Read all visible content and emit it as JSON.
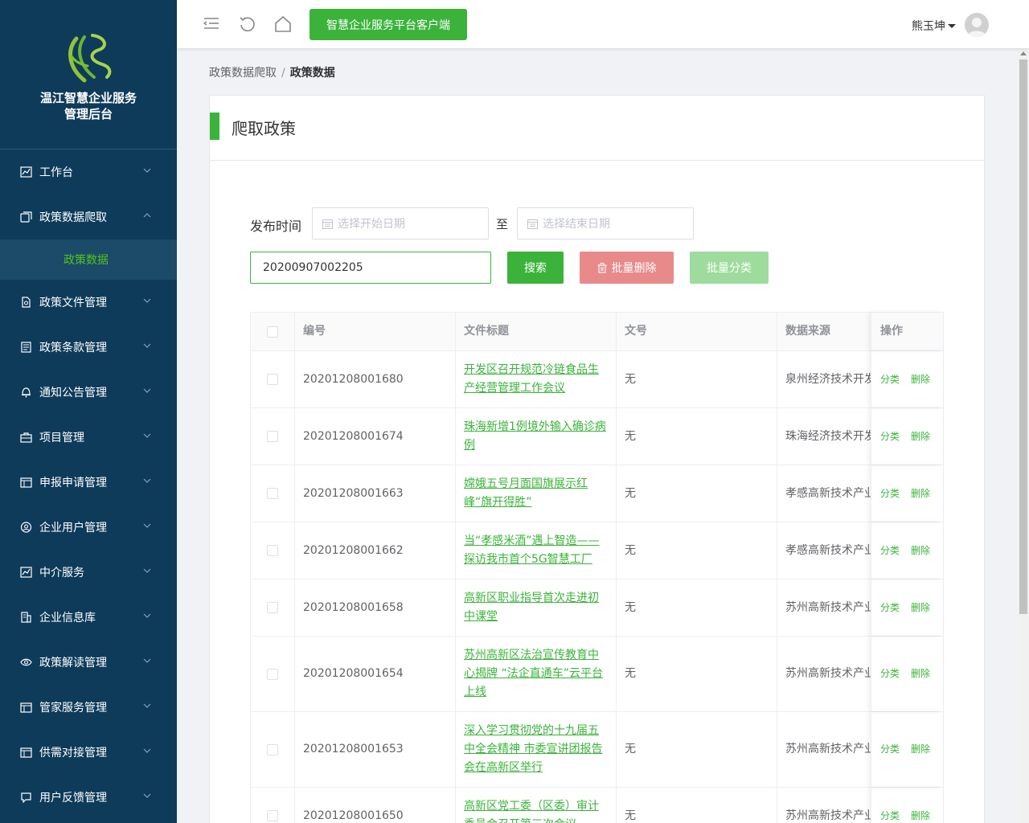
{
  "brand": {
    "title_line1": "温江智慧企业服务",
    "title_line2": "管理后台"
  },
  "sidebar": {
    "items": [
      {
        "label": "工作台",
        "icon": "chart-icon"
      },
      {
        "label": "政策数据爬取",
        "icon": "layers-icon",
        "expanded": true
      },
      {
        "label": "政策文件管理",
        "icon": "file-icon"
      },
      {
        "label": "政策条款管理",
        "icon": "document-icon"
      },
      {
        "label": "通知公告管理",
        "icon": "bell-icon"
      },
      {
        "label": "项目管理",
        "icon": "briefcase-icon"
      },
      {
        "label": "申报申请管理",
        "icon": "calendar-icon"
      },
      {
        "label": "企业用户管理",
        "icon": "user-circle-icon"
      },
      {
        "label": "中介服务",
        "icon": "chart-icon"
      },
      {
        "label": "企业信息库",
        "icon": "building-icon"
      },
      {
        "label": "政策解读管理",
        "icon": "eye-icon"
      },
      {
        "label": "管家服务管理",
        "icon": "calendar-icon"
      },
      {
        "label": "供需对接管理",
        "icon": "calendar-icon"
      },
      {
        "label": "用户反馈管理",
        "icon": "chat-icon"
      }
    ],
    "submenu_active": "政策数据"
  },
  "header": {
    "client_button": "智慧企业服务平台客户端",
    "user_name": "熊玉坤"
  },
  "breadcrumb": {
    "parent": "政策数据爬取",
    "separator": "/",
    "current": "政策数据"
  },
  "card": {
    "title": "爬取政策"
  },
  "filters": {
    "publish_time_label": "发布时间",
    "start_placeholder": "选择开始日期",
    "to_label": "至",
    "end_placeholder": "选择结束日期",
    "search_value": "20200907002205",
    "search_button": "搜索",
    "batch_delete_button": "批量删除",
    "batch_classify_button": "批量分类"
  },
  "table": {
    "columns": [
      "编号",
      "文件标题",
      "文号",
      "数据来源",
      "操作"
    ],
    "op_classify": "分类",
    "op_delete": "删除",
    "rows": [
      {
        "no": "20201208001680",
        "title": "开发区召开规范冷链食品生产经营管理工作会议",
        "doc": "无",
        "source": "泉州经济技术开发区"
      },
      {
        "no": "20201208001674",
        "title": "珠海新增1例境外输入确诊病例",
        "doc": "无",
        "source": "珠海经济技术开发区"
      },
      {
        "no": "20201208001663",
        "title": "嫦娥五号月面国旗展示红峰“旗开得胜”",
        "doc": "无",
        "source": "孝感高新技术产业开发区"
      },
      {
        "no": "20201208001662",
        "title": "当“孝感米酒”遇上智造——探访我市首个5G智慧工厂",
        "doc": "无",
        "source": "孝感高新技术产业开发区"
      },
      {
        "no": "20201208001658",
        "title": "高新区职业指导首次走进初中课堂",
        "doc": "无",
        "source": "苏州高新技术产业开发区"
      },
      {
        "no": "20201208001654",
        "title": "苏州高新区法治宣传教育中心揭牌 “法企直通车”云平台上线",
        "doc": "无",
        "source": "苏州高新技术产业开发区"
      },
      {
        "no": "20201208001653",
        "title": "深入学习贯彻党的十九届五中全会精神 市委宣讲团报告会在高新区举行",
        "doc": "无",
        "source": "苏州高新技术产业开发区"
      },
      {
        "no": "20201208001650",
        "title": "高新区党工委（区委）审计委员会召开第三次会议",
        "doc": "无",
        "source": "苏州高新技术产业开发区"
      }
    ]
  },
  "colors": {
    "sidebar_bg": "#0e3b5a",
    "accent_green": "#3bb33b",
    "danger_soft": "#e88a8a"
  }
}
